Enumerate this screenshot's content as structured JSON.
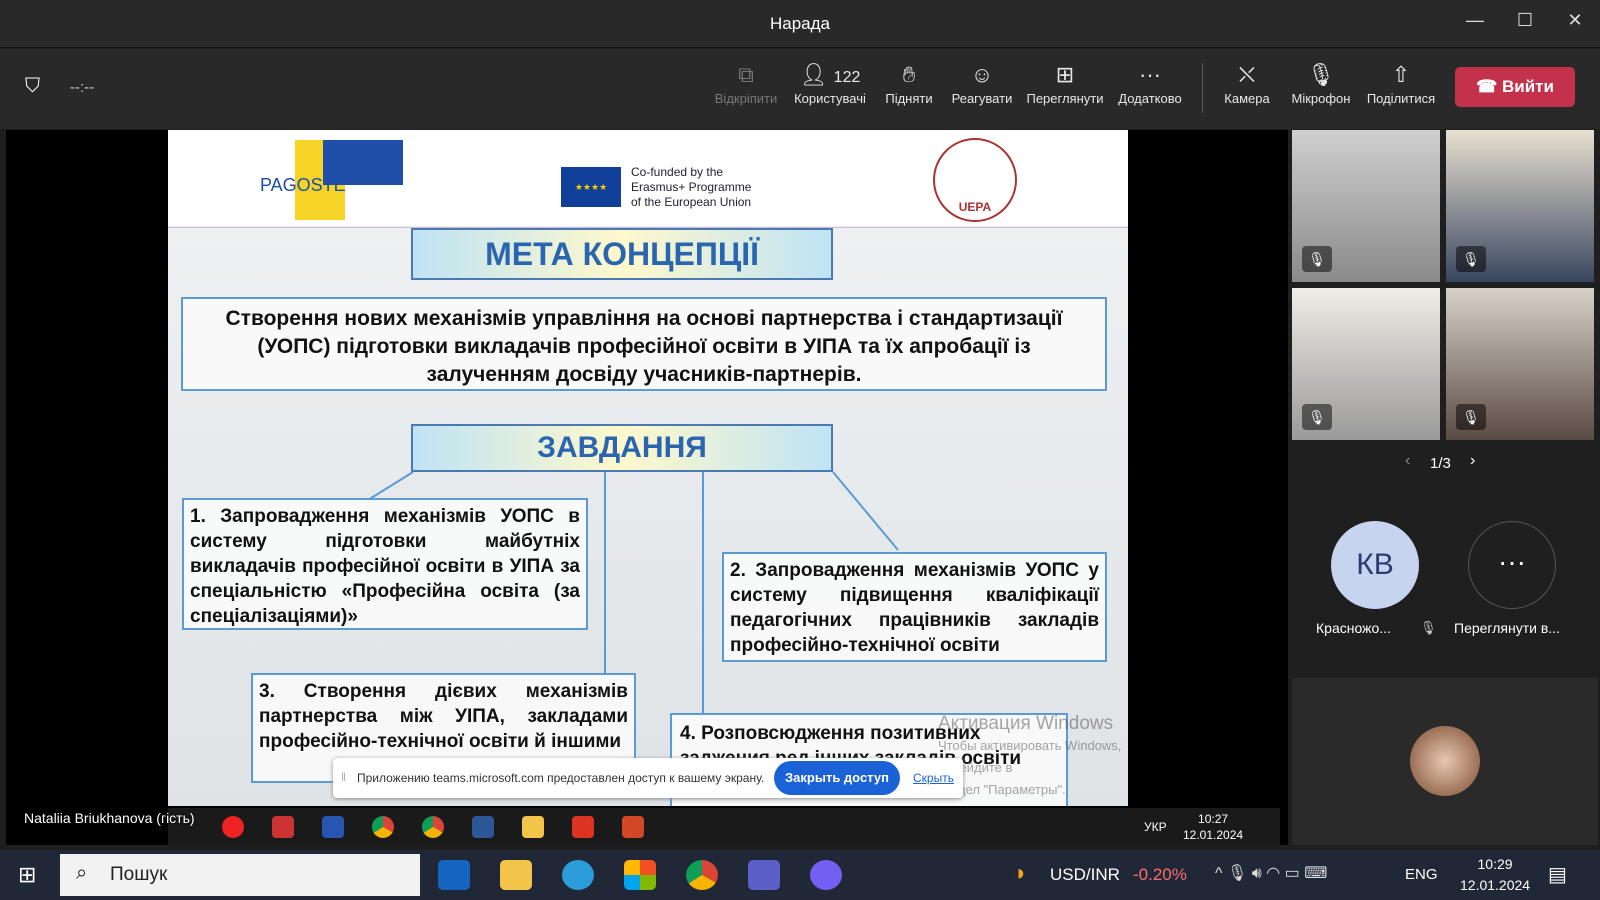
{
  "window": {
    "title": "Нарада"
  },
  "toolbar": {
    "timer": "--:--",
    "unpin": "Відкріпити",
    "users": "Користувачі",
    "users_count": "122",
    "raise": "Підняти",
    "react": "Реагувати",
    "view": "Переглянути",
    "more": "Додатково",
    "camera": "Камера",
    "mic": "Мікрофон",
    "share": "Поділитися",
    "leave": "Вийти"
  },
  "slide": {
    "logo_left": "PAGOSTE",
    "cofunded": [
      "Co-funded by the",
      "Erasmus+ Programme",
      "of the European Union"
    ],
    "logo_right": "UEPA",
    "goal_title": "МЕТА КОНЦЕПЦІЇ",
    "goal_text": "Створення нових механізмів управління на основі партнерства і стандартизації (УОПС) підготовки викладачів професійної освіти в УІПА та їх апробації  із залученням досвіду учасників-партнерів.",
    "tasks_title": "ЗАВДАННЯ",
    "task1": "1. Запровадження механізмів УОПС в систему підготовки майбутніх викладачів професійної освіти в УІПА за спеціальністю «Професійна освіта (за спеціалізаціями)»",
    "task2": "2. Запровадження механізмів УОПС у систему підвищення кваліфікації педагогічних працівників закладів професійно-технічної освіти",
    "task3": "3. Створення дієвих механізмів партнерства між УІПА, закладами професійно-технічної освіти й іншими",
    "task4": "4. Розповсюдження позитивних заджения ред інших закладів освіти",
    "watermark": [
      "Активация Windows",
      "Чтобы активировать Windows, перейдите в",
      "раздел \"Параметры\"."
    ]
  },
  "sharebar": {
    "text": "Приложению teams.microsoft.com предоставлен доступ к вашему экрану.",
    "stop": "Закрыть доступ",
    "hide": "Скрыть"
  },
  "presenter": {
    "name": "Nataliia Briukhanova (гість)"
  },
  "remote_tray": {
    "lang": "УКР",
    "time": "10:27",
    "date": "12.01.2024"
  },
  "gallery": {
    "page": "1/3",
    "kb_initials": "КВ",
    "kb_name": "Красножо...",
    "more_label": "Переглянути в..."
  },
  "taskbar": {
    "search": "Пошук",
    "ticker": "USD/INR",
    "change": "-0.20%",
    "lang": "ENG",
    "time": "10:29",
    "date": "12.01.2024"
  }
}
